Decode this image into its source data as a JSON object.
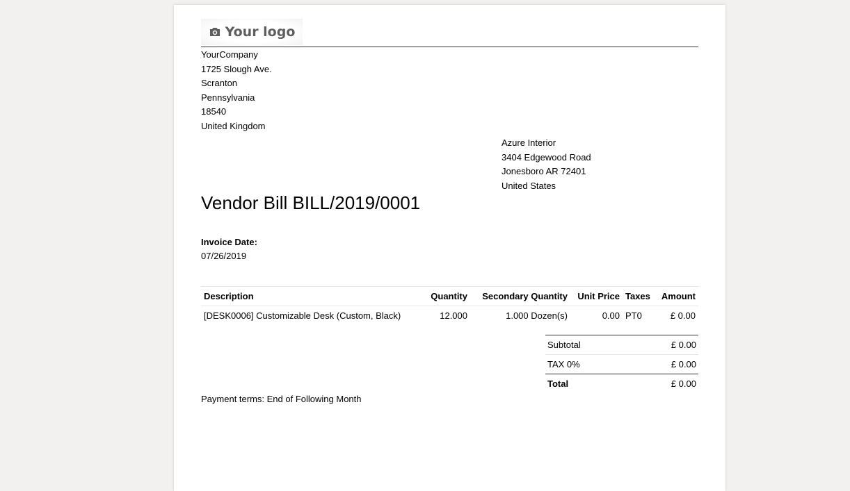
{
  "logo": {
    "text": "Your logo",
    "icon": "camera-icon"
  },
  "company": {
    "name": "YourCompany",
    "street": "1725 Slough Ave.",
    "city": "Scranton",
    "state": "Pennsylvania",
    "zip": "18540",
    "country": "United Kingdom"
  },
  "partner": {
    "name": "Azure Interior",
    "street": "3404 Edgewood Road",
    "city_line": "Jonesboro AR 72401",
    "country": "United States"
  },
  "document": {
    "title": "Vendor Bill BILL/2019/0001",
    "invoice_date_label": "Invoice Date:",
    "invoice_date": "07/26/2019"
  },
  "table": {
    "headers": {
      "description": "Description",
      "quantity": "Quantity",
      "secondary_quantity": "Secondary Quantity",
      "unit_price": "Unit Price",
      "taxes": "Taxes",
      "amount": "Amount"
    },
    "rows": [
      {
        "description": "[DESK0006] Customizable Desk (Custom, Black)",
        "quantity": "12.000",
        "secondary_quantity": "1.000 Dozen(s)",
        "unit_price": "0.00",
        "taxes": "PT0",
        "amount": "£ 0.00"
      }
    ]
  },
  "totals": {
    "subtotal_label": "Subtotal",
    "subtotal": "£ 0.00",
    "tax_label": "TAX 0%",
    "tax": "£ 0.00",
    "total_label": "Total",
    "total": "£ 0.00"
  },
  "payment_terms": "Payment terms: End of Following Month"
}
